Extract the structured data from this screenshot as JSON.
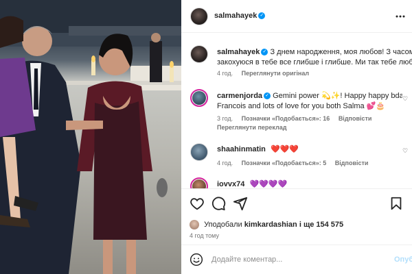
{
  "post": {
    "author": "salmahayek",
    "caption_line1": "З днем народження, моя любов! З часом я",
    "caption_line2": "закохуюся в тебе все глибше і глибше. Ми так тебе любимо",
    "caption_time": "4 год.",
    "see_original": "Переглянути оригінал"
  },
  "comments": [
    {
      "user": "carmenjorda",
      "verified": true,
      "line1": "Gemini power 💫✨! Happy happy bday to",
      "line2": "Francois and lots of love for you both Salma 💕🎂",
      "time": "3 год.",
      "likes": "Позначки «Подобається»: 16",
      "reply": "Відповісти",
      "translate": "Переглянути переклад"
    },
    {
      "user": "shaahinmatin",
      "text": "❤️❤️❤️",
      "time": "4 год.",
      "likes": "Позначки «Подобається»: 5",
      "reply": "Відповісти"
    },
    {
      "user": "iovvx74",
      "text": "💜💜💜💜"
    }
  ],
  "actions": {
    "liked_by_prefix": "Уподобали",
    "liked_by_user": "kimkardashian",
    "liked_by_suffix": "і ще 154 575",
    "time": "4 год тому"
  },
  "add_comment": {
    "placeholder": "Додайте коментар...",
    "post_label": "Опубл"
  },
  "colors": {
    "verified": "#0095f6",
    "muted": "#737373",
    "post_disabled": "#b2dffc",
    "dress": "#3a1620",
    "cardigan": "#5a1a26"
  }
}
